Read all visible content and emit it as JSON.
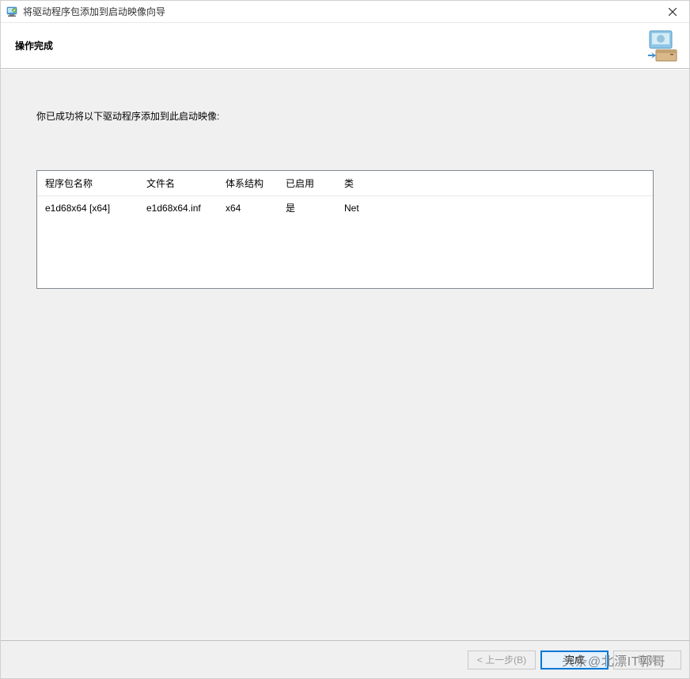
{
  "window": {
    "title": "将驱动程序包添加到启动映像向导"
  },
  "header": {
    "subtitle": "操作完成"
  },
  "content": {
    "instruction": "你已成功将以下驱动程序添加到此启动映像:"
  },
  "table": {
    "columns": {
      "package_name": "程序包名称",
      "file_name": "文件名",
      "architecture": "体系结构",
      "enabled": "已启用",
      "class": "类"
    },
    "rows": [
      {
        "package_name": "e1d68x64 [x64]",
        "file_name": "e1d68x64.inf",
        "architecture": "x64",
        "enabled": "是",
        "class": "Net"
      }
    ]
  },
  "footer": {
    "back": "< 上一步(B)",
    "finish": "完成",
    "cancel": "取消"
  },
  "watermark": "头条@北漂IT郭哥"
}
